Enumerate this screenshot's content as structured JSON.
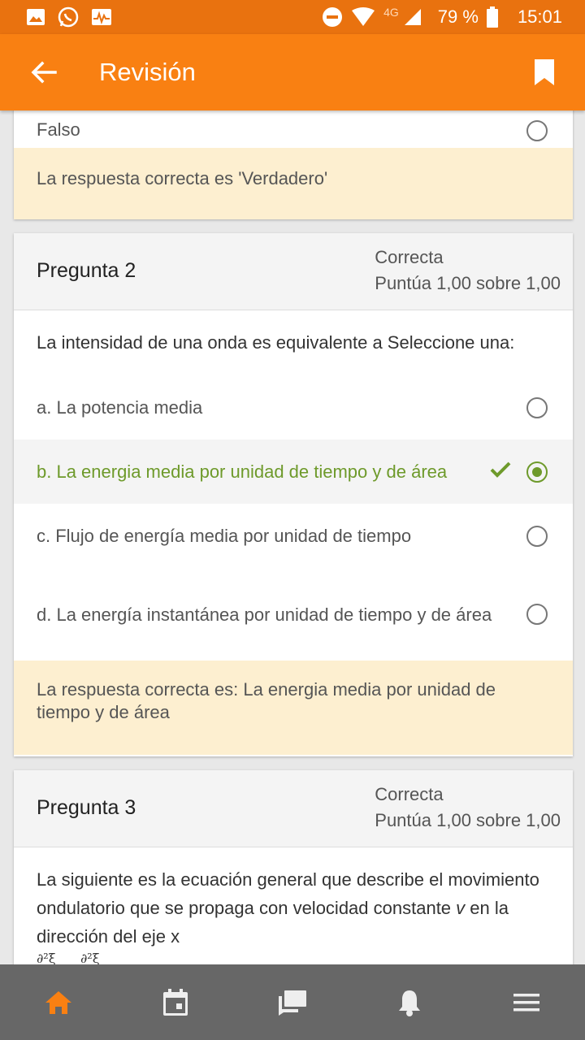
{
  "status_bar": {
    "network": "4G",
    "battery": "79 %",
    "time": "15:01"
  },
  "app_bar": {
    "title": "Revisión"
  },
  "question1": {
    "option_partial": "Falso",
    "feedback": "La respuesta correcta es 'Verdadero'"
  },
  "question2": {
    "title": "Pregunta 2",
    "state": "Correcta",
    "grade": "Puntúa 1,00 sobre 1,00",
    "text": "La intensidad de una onda es equivalente a Seleccione una:",
    "options": [
      {
        "label": "a. La potencia media",
        "selected": false
      },
      {
        "label": "b. La energia media por unidad de tiempo y de área",
        "selected": true
      },
      {
        "label": "c. Flujo de energía media por unidad de tiempo",
        "selected": false
      },
      {
        "label": "d. La energía instantánea por unidad de tiempo y de área",
        "selected": false
      }
    ],
    "feedback": "La respuesta correcta es: La energia media por unidad de tiempo y de área"
  },
  "question3": {
    "title": "Pregunta 3",
    "state": "Correcta",
    "grade": "Puntúa 1,00 sobre 1,00",
    "text_part1": "La siguiente es la ecuación general que describe el movimiento ondulatorio que se propaga con velocidad constante ",
    "text_var": "v",
    "text_part2": " en la dirección del eje x",
    "math_partial": "∂²ξ      ∂²ξ"
  },
  "bottom_nav": {
    "items": [
      "home-icon",
      "calendar-icon",
      "messages-icon",
      "notifications-icon",
      "menu-icon"
    ],
    "active": "home-icon"
  },
  "colors": {
    "primary": "#f98012",
    "status_bar": "#e9720f",
    "correct": "#6e9a2b",
    "feedback_bg": "#fdefd0",
    "nav_bg": "#676767"
  }
}
